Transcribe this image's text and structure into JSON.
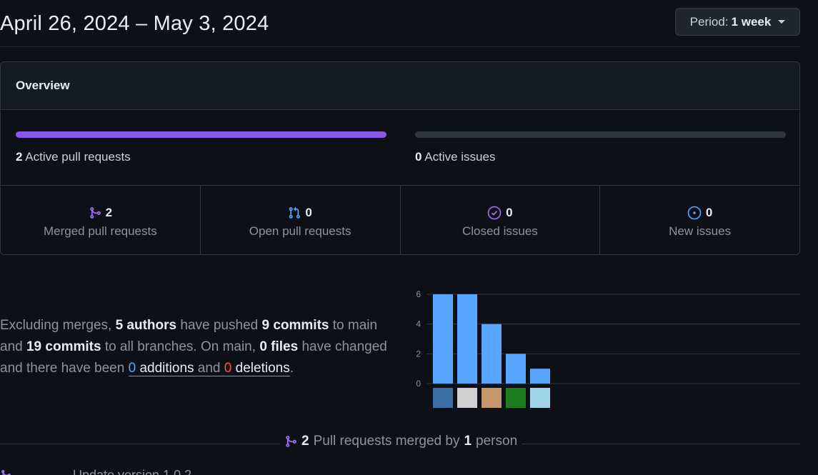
{
  "header": {
    "date_range": "April 26, 2024 – May 3, 2024",
    "period_prefix": "Period:",
    "period_value": "1 week"
  },
  "overview": {
    "title": "Overview",
    "active_prs": {
      "count": "2",
      "label": "Active pull requests",
      "fill_fraction": 1.0
    },
    "active_issues": {
      "count": "0",
      "label": "Active issues",
      "fill_fraction": 0.0
    },
    "stats": [
      {
        "icon": "git-merge-icon",
        "count": "2",
        "label": "Merged pull requests",
        "color": "#a371f7"
      },
      {
        "icon": "git-pull-request-icon",
        "count": "0",
        "label": "Open pull requests",
        "color": "#58a6ff"
      },
      {
        "icon": "issue-closed-icon",
        "count": "0",
        "label": "Closed issues",
        "color": "#a371f7"
      },
      {
        "icon": "issue-opened-icon",
        "count": "0",
        "label": "New issues",
        "color": "#58a6ff"
      }
    ]
  },
  "summary": {
    "p1": "Excluding merges,",
    "authors": "5 authors",
    "p2": "have pushed",
    "commits_main": "9 commits",
    "p3": "to main and",
    "commits_all": "19 commits",
    "p4": "to all branches. On main,",
    "files": "0 files",
    "p5": "have changed and there have been",
    "additions_num": "0",
    "additions_word": "additions",
    "and_word": "and",
    "deletions_num": "0",
    "deletions_word": "deletions",
    "period": "."
  },
  "colors": {
    "bar": "#58a6ff",
    "accent_purple": "#8957e5",
    "addition": "#58a6ff",
    "deletion": "#f85149"
  },
  "chart_data": {
    "type": "bar",
    "categories": [
      "author-1",
      "author-2",
      "author-3",
      "author-4",
      "author-5"
    ],
    "values": [
      6,
      6,
      4,
      2,
      1
    ],
    "ylim": [
      0,
      6
    ],
    "yticks": [
      "0",
      "2",
      "4",
      "6"
    ],
    "grid": true,
    "avatar_colors": [
      "#3a6ea5",
      "#d0d0d0",
      "#c49a6c",
      "#1b7d1b",
      "#9fd6e8"
    ]
  },
  "merged": {
    "count": "2",
    "text_a": "Pull requests merged by",
    "people": "1",
    "text_b": "person"
  },
  "clipped_row": {
    "text": "Update version 1.0.2"
  }
}
